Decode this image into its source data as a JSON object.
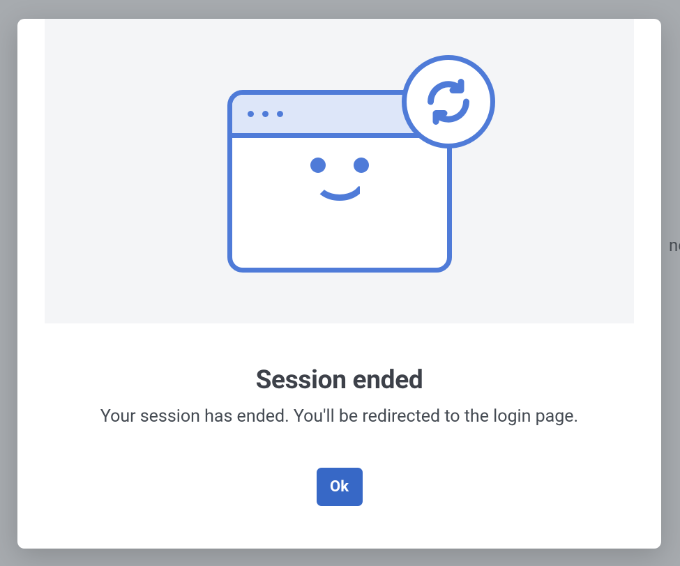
{
  "dialog": {
    "title": "Session ended",
    "message": "Your session has ended. You'll be redirected to the login page.",
    "ok_label": "Ok"
  },
  "background_fragment": "ne"
}
